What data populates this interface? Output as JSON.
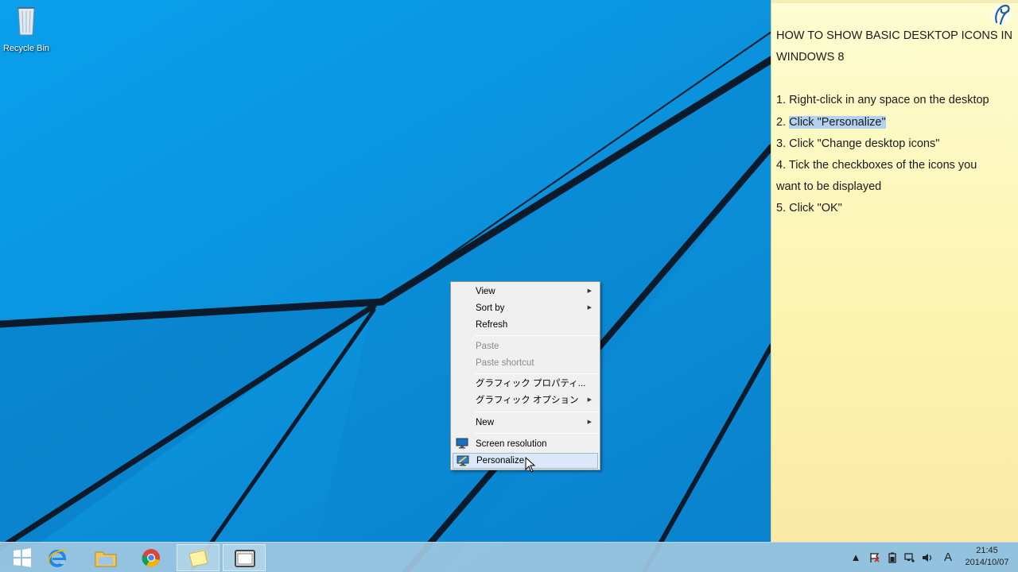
{
  "desktop": {
    "icons": [
      {
        "label": "Recycle Bin",
        "icon": "recycle-bin-icon"
      }
    ]
  },
  "note": {
    "title_line1": "HOW TO SHOW BASIC DESKTOP ICONS IN",
    "title_line2": "WINDOWS 8",
    "steps": [
      {
        "num": "1.",
        "text": "Right-click in any space on the desktop"
      },
      {
        "num": "2.",
        "text": "Click \"Personalize\""
      },
      {
        "num": "3.",
        "text": "Click \"Change desktop icons\""
      },
      {
        "num": "4.",
        "text": "Tick the checkboxes of the icons you"
      },
      {
        "num": "",
        "text": "want to be displayed"
      },
      {
        "num": "5.",
        "text": "Click \"OK\""
      }
    ],
    "highlight_color": "#b4d2f0"
  },
  "context_menu": {
    "items": [
      {
        "label": "View",
        "submenu": true
      },
      {
        "label": "Sort by",
        "submenu": true
      },
      {
        "label": "Refresh"
      },
      {
        "label": "Paste",
        "disabled": true
      },
      {
        "label": "Paste shortcut",
        "disabled": true
      },
      {
        "label": "グラフィック プロパティ..."
      },
      {
        "label": "グラフィック オプション",
        "submenu": true
      },
      {
        "label": "New",
        "submenu": true
      },
      {
        "label": "Screen resolution",
        "icon": "monitor-icon"
      },
      {
        "label": "Personalize",
        "icon": "personalize-icon",
        "selected": true
      }
    ],
    "submenu_arrow": "▶"
  },
  "taskbar": {
    "pinned": [
      {
        "name": "start-button",
        "icon": "windows-logo-icon"
      },
      {
        "name": "internet-explorer",
        "icon": "ie-icon"
      },
      {
        "name": "file-explorer",
        "icon": "folder-icon"
      },
      {
        "name": "chrome",
        "icon": "chrome-icon"
      },
      {
        "name": "sticky-notes",
        "icon": "sticky-notes-icon",
        "active": true
      },
      {
        "name": "recorder",
        "icon": "video-window-icon",
        "active": true
      }
    ],
    "tray": {
      "ime_indicator": "A",
      "time": "21:45",
      "date": "2014/10/07"
    }
  },
  "colors": {
    "desktop_blue": "#0a8fd8",
    "note_yellow": "#fdf3b0",
    "taskbar": "#a0c8e1"
  }
}
